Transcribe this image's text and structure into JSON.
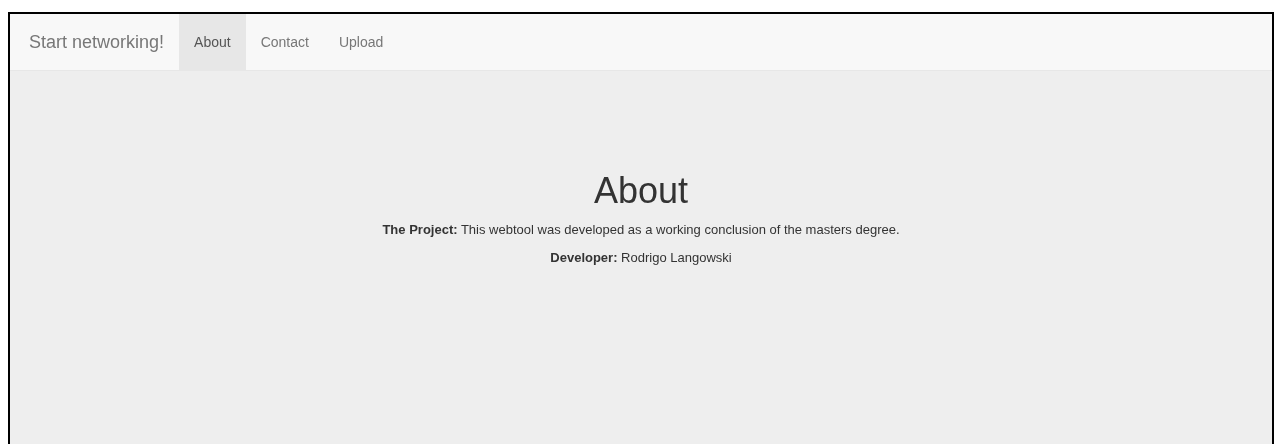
{
  "navbar": {
    "brand": "Start networking!",
    "links": [
      {
        "label": "About",
        "selected": true
      },
      {
        "label": "Contact",
        "selected": false
      },
      {
        "label": "Upload",
        "selected": false
      }
    ]
  },
  "content": {
    "title": "About",
    "paragraphs": [
      "**The Project:** This webtool was developed as a working conclusion of the masters degree.",
      "**Developer:** Rodrigo Langowski"
    ]
  }
}
